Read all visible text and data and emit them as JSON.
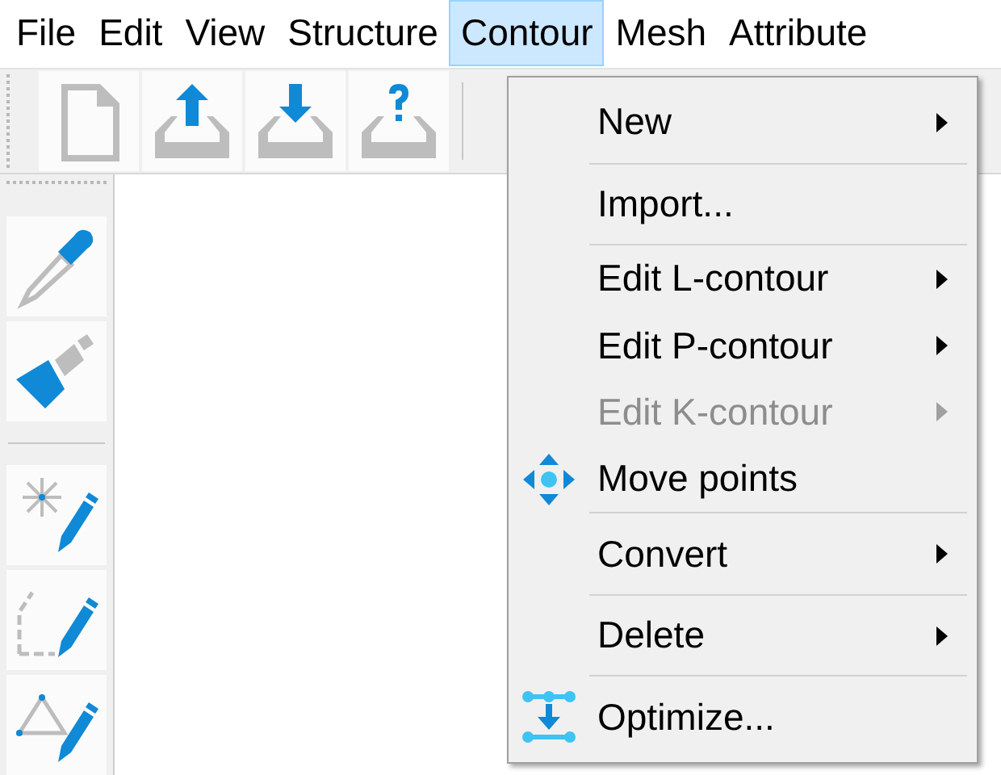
{
  "menubar": [
    {
      "label": "File",
      "selected": false
    },
    {
      "label": "Edit",
      "selected": false
    },
    {
      "label": "View",
      "selected": false
    },
    {
      "label": "Structure",
      "selected": false
    },
    {
      "label": "Contour",
      "selected": true
    },
    {
      "label": "Mesh",
      "selected": false
    },
    {
      "label": "Attribute",
      "selected": false
    }
  ],
  "menu": {
    "groups": [
      [
        {
          "label": "New",
          "submenu": true,
          "disabled": false,
          "kind": "plain"
        }
      ],
      [
        {
          "label": "Import...",
          "submenu": false,
          "disabled": false,
          "kind": "plain"
        }
      ],
      [
        {
          "label": "Edit L-contour",
          "submenu": true,
          "disabled": false,
          "kind": "plain"
        },
        {
          "label": "Edit P-contour",
          "submenu": true,
          "disabled": false,
          "kind": "plain"
        },
        {
          "label": "Edit K-contour",
          "submenu": true,
          "disabled": true,
          "kind": "plain"
        },
        {
          "label": "Move points",
          "submenu": false,
          "disabled": false,
          "kind": "move"
        }
      ],
      [
        {
          "label": "Convert",
          "submenu": true,
          "disabled": false,
          "kind": "plain"
        }
      ],
      [
        {
          "label": "Delete",
          "submenu": true,
          "disabled": false,
          "kind": "plain"
        }
      ],
      [
        {
          "label": "Optimize...",
          "submenu": false,
          "disabled": false,
          "kind": "optimize"
        }
      ]
    ]
  }
}
